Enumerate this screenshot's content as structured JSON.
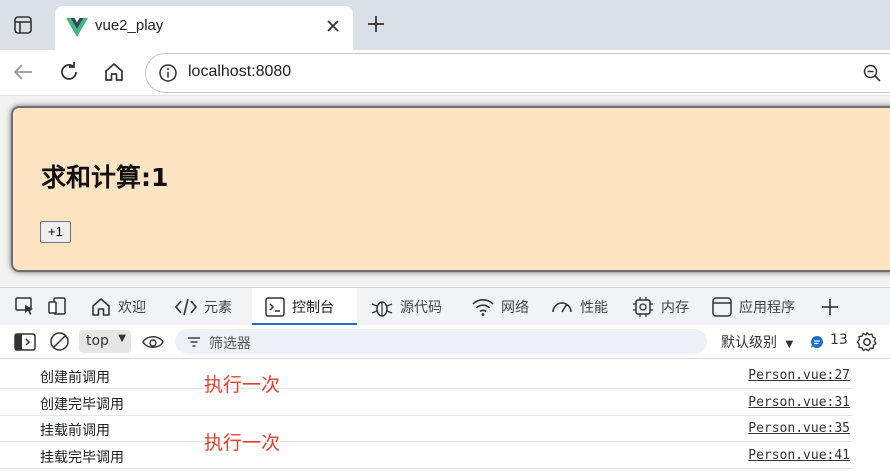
{
  "browser": {
    "tab_title": "vue2_play",
    "url": "localhost:8080"
  },
  "page": {
    "heading": "求和计算:1",
    "plus_button": "+1",
    "box_color": "#ffe4c4"
  },
  "devtools": {
    "tabs": [
      {
        "label": "欢迎",
        "icon": "home-icon"
      },
      {
        "label": "元素",
        "icon": "code-icon"
      },
      {
        "label": "控制台",
        "icon": "console-icon",
        "active": true
      },
      {
        "label": "源代码",
        "icon": "bug-icon"
      },
      {
        "label": "网络",
        "icon": "wifi-icon"
      },
      {
        "label": "性能",
        "icon": "gauge-icon"
      },
      {
        "label": "内存",
        "icon": "chip-icon"
      },
      {
        "label": "应用程序",
        "icon": "window-icon"
      }
    ],
    "context": "top",
    "filter_placeholder": "筛选器",
    "level": "默认级别",
    "message_count": "13",
    "accent": "#1a6fd3",
    "logs": [
      {
        "message": "创建前调用",
        "source": "Person.vue:27"
      },
      {
        "message": "创建完毕调用",
        "source": "Person.vue:31"
      },
      {
        "message": "挂载前调用",
        "source": "Person.vue:35"
      },
      {
        "message": "挂载完毕调用",
        "source": "Person.vue:41"
      }
    ]
  },
  "annotations": {
    "note_1": "执行一次",
    "note_2": "执行一次",
    "color": "#e5402a"
  }
}
